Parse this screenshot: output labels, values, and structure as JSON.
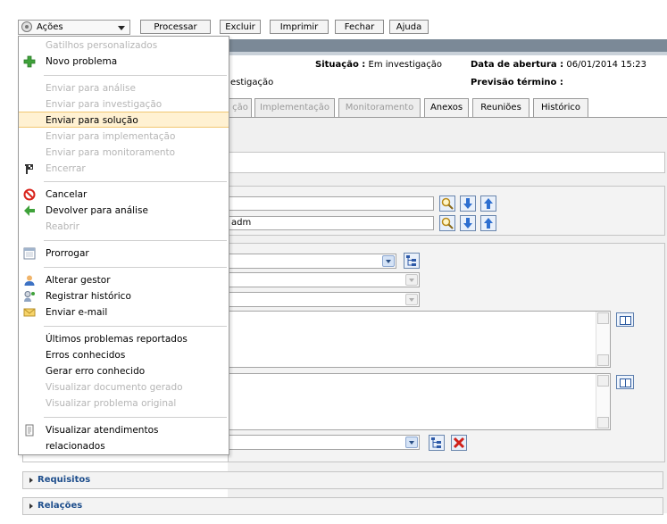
{
  "toolbar": {
    "acoes_label": "Ações",
    "processar_label": "Processar",
    "excluir_label": "Excluir",
    "imprimir_label": "Imprimir",
    "fechar_label": "Fechar",
    "ajuda_label": "Ajuda"
  },
  "header": {
    "situacao_label": "Situação :",
    "situacao_value": "Em investigação",
    "data_abertura_label": "Data de abertura :",
    "data_abertura_value": "06/01/2014 15:23",
    "status_partial": "estigação",
    "previsao_label": "Previsão término :"
  },
  "tabs": [
    {
      "label": "ção",
      "enabled": false
    },
    {
      "label": "Implementação",
      "enabled": false
    },
    {
      "label": "Monitoramento",
      "enabled": false
    },
    {
      "label": "Anexos",
      "enabled": true
    },
    {
      "label": "Reuniões",
      "enabled": true
    },
    {
      "label": "Histórico",
      "enabled": true
    }
  ],
  "form": {
    "field2_value": "adm"
  },
  "sections": {
    "requisitos": "Requisitos",
    "relacoes": "Relações"
  },
  "menu": {
    "items": [
      {
        "label": "Gatilhos personalizados",
        "enabled": false,
        "icon": ""
      },
      {
        "label": "Novo problema",
        "enabled": true,
        "icon": "plus-icon"
      },
      {
        "label": "Enviar para análise",
        "enabled": false,
        "icon": ""
      },
      {
        "label": "Enviar para investigação",
        "enabled": false,
        "icon": ""
      },
      {
        "label": "Enviar para solução",
        "enabled": true,
        "icon": "",
        "highlighted": true
      },
      {
        "label": "Enviar para implementação",
        "enabled": false,
        "icon": ""
      },
      {
        "label": "Enviar para monitoramento",
        "enabled": false,
        "icon": ""
      },
      {
        "label": "Encerrar",
        "enabled": false,
        "icon": "close-flag-icon"
      },
      {
        "label": "Cancelar",
        "enabled": true,
        "icon": "cancel-icon"
      },
      {
        "label": "Devolver para análise",
        "enabled": true,
        "icon": "arrow-left-icon"
      },
      {
        "label": "Reabrir",
        "enabled": false,
        "icon": ""
      },
      {
        "label": "Prorrogar",
        "enabled": true,
        "icon": "calendar-icon"
      },
      {
        "label": "Alterar gestor",
        "enabled": true,
        "icon": "user-icon"
      },
      {
        "label": "Registrar histórico",
        "enabled": true,
        "icon": "history-user-icon"
      },
      {
        "label": "Enviar e-mail",
        "enabled": true,
        "icon": "mail-icon"
      },
      {
        "label": "Últimos problemas reportados",
        "enabled": true,
        "icon": ""
      },
      {
        "label": "Erros conhecidos",
        "enabled": true,
        "icon": ""
      },
      {
        "label": "Gerar erro conhecido",
        "enabled": true,
        "icon": ""
      },
      {
        "label": "Visualizar documento gerado",
        "enabled": false,
        "icon": ""
      },
      {
        "label": "Visualizar problema original",
        "enabled": false,
        "icon": ""
      },
      {
        "label": "Visualizar atendimentos",
        "enabled": true,
        "icon": "document-icon"
      },
      {
        "label": "relacionados",
        "enabled": true,
        "icon": ""
      }
    ]
  },
  "colors": {
    "header_band": "#7b8997",
    "menu_highlight": "#fff1d2",
    "section_title": "#1e4e8c",
    "disabled_text": "#b5b5b5"
  }
}
